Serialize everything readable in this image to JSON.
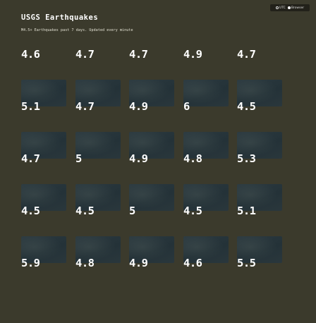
{
  "header": {
    "title": "USGS Earthquakes",
    "subtitle": "M4.5+ Earthquakes past 7 days. Updated every minute"
  },
  "timezone_toggle": {
    "options": [
      "UTC",
      "Browser"
    ],
    "selected": "Browser"
  },
  "quakes": [
    [
      "4.6",
      "4.7",
      "4.7",
      "4.9",
      "4.7"
    ],
    [
      "5.1",
      "4.7",
      "4.9",
      "6",
      "4.5"
    ],
    [
      "4.7",
      "5",
      "4.9",
      "4.8",
      "5.3"
    ],
    [
      "4.5",
      "4.5",
      "5",
      "4.5",
      "5.1"
    ],
    [
      "5.9",
      "4.8",
      "4.9",
      "4.6",
      "5.5"
    ]
  ]
}
